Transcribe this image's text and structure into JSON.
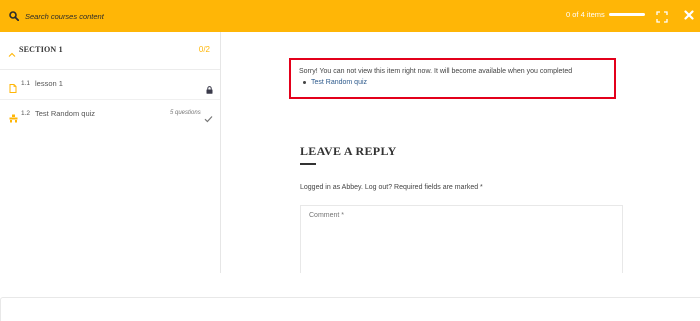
{
  "topbar": {
    "search_placeholder": "Search courses content",
    "progress_text": "0 of 4 items",
    "progress_fraction": 0,
    "accent_color": "#ffb606",
    "icons": [
      "search-icon",
      "fullscreen-icon",
      "close-icon"
    ]
  },
  "sidebar": {
    "section": {
      "title": "SECTION 1",
      "count": "0/2"
    },
    "items": [
      {
        "number": "1.1",
        "label": "lesson 1",
        "meta": "",
        "icon": "document-icon",
        "status_icon": "lock-icon"
      },
      {
        "number": "1.2",
        "label": "Test Random quiz",
        "meta": "5 questions",
        "icon": "quiz-icon",
        "status_icon": "check-icon"
      }
    ]
  },
  "main": {
    "notice": {
      "text": "Sorry! You can not view this item right now. It will become available when you completed",
      "link": "Test Random quiz",
      "highlight_color": "#e3001b"
    },
    "reply": {
      "title": "LEAVE A REPLY",
      "logged_in": "Logged in as Abbey. Log out? Required fields are marked *",
      "comment_placeholder": "Comment *"
    }
  }
}
